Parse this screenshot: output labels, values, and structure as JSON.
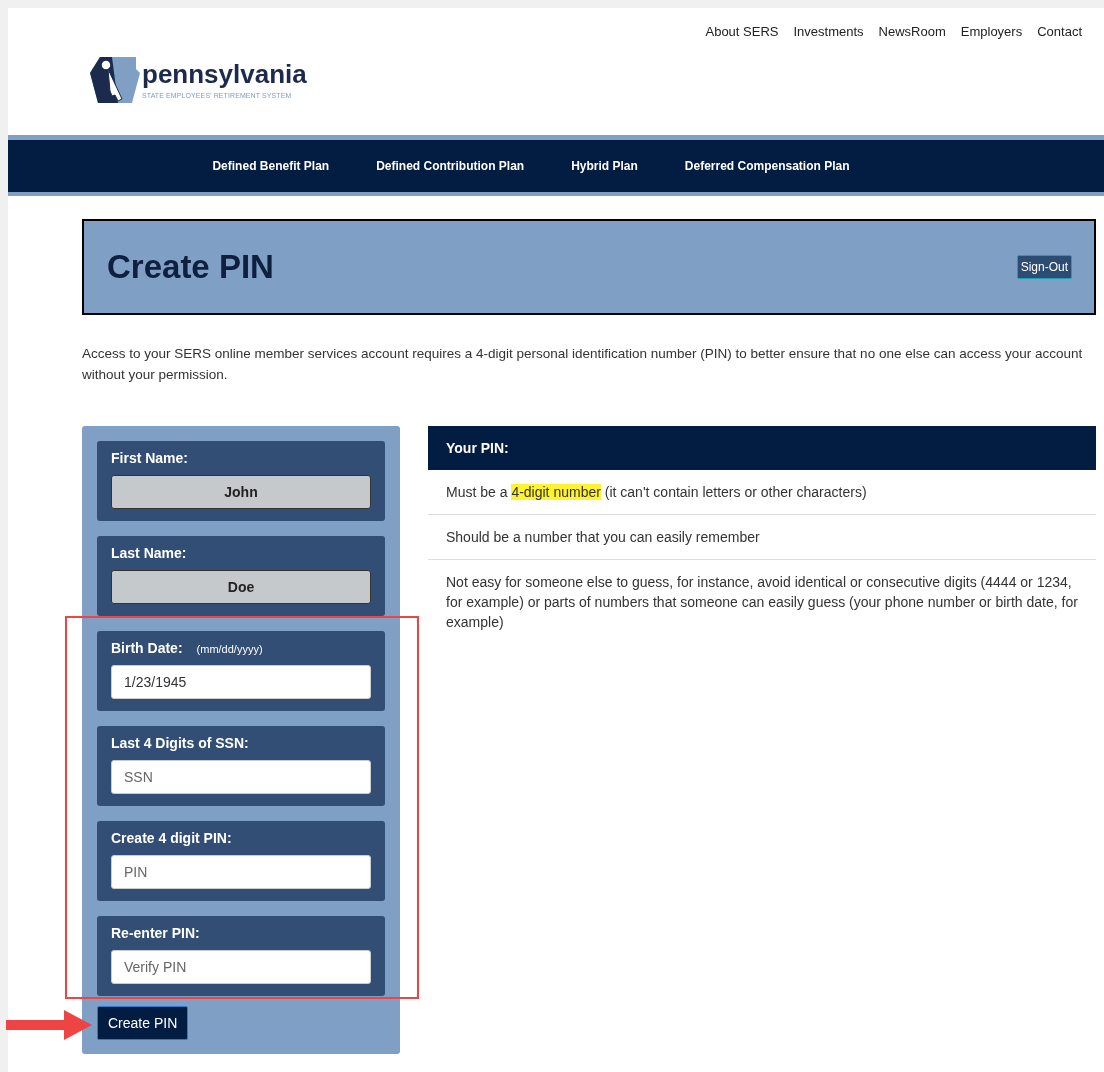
{
  "logo": {
    "name": "pennsylvania",
    "tagline": "STATE EMPLOYEES' RETIREMENT SYSTEM"
  },
  "top_links": [
    "About SERS",
    "Investments",
    "NewsRoom",
    "Employers",
    "Contact"
  ],
  "main_nav": [
    "Defined Benefit Plan",
    "Defined Contribution Plan",
    "Hybrid Plan",
    "Deferred Compensation Plan"
  ],
  "banner": {
    "title": "Create PIN",
    "button": "Sign-Out"
  },
  "intro": "Access to your SERS online member services account requires a 4-digit personal identification number (PIN) to better ensure that no one else can access your account without your permission.",
  "form": {
    "fields": [
      {
        "label": "First Name:",
        "kind": "readonly",
        "value": "John"
      },
      {
        "label": "Last Name:",
        "kind": "readonly",
        "value": "Doe"
      },
      {
        "label": "Birth Date:",
        "hint": "(mm/dd/yyyy)",
        "kind": "input",
        "value": "1/23/1945"
      },
      {
        "label": "Last 4 Digits of SSN:",
        "kind": "input",
        "placeholder": "SSN"
      },
      {
        "label": "Create 4 digit PIN:",
        "kind": "input",
        "placeholder": "PIN"
      },
      {
        "label": "Re-enter PIN:",
        "kind": "input",
        "placeholder": "Verify PIN"
      }
    ],
    "submit": "Create PIN"
  },
  "pin_rules": {
    "title": "Your PIN:",
    "items": [
      [
        {
          "text": "Must be a ",
          "highlight": false
        },
        {
          "text": "4-digit number",
          "highlight": true
        },
        {
          "text": " (it can't contain letters or other characters)",
          "highlight": false
        }
      ],
      [
        {
          "text": "Should be a number that you can easily remember",
          "highlight": false
        }
      ],
      [
        {
          "text": "Not easy for someone else to guess, for instance, avoid identical or consecutive digits (4444 or 1234, for example) or parts of numbers that someone can easily guess (your phone number or birth date, for example)",
          "highlight": false
        }
      ]
    ]
  }
}
